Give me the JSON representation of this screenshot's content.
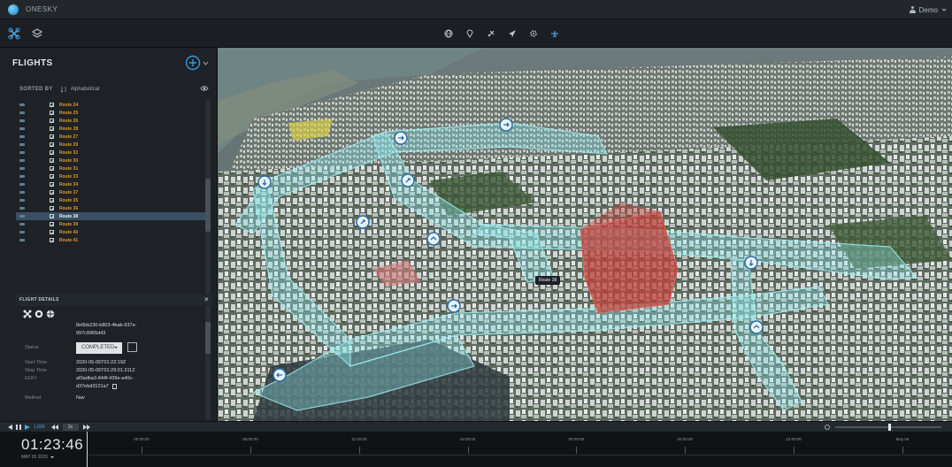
{
  "app": {
    "name": "ONESKY",
    "user": "Demo"
  },
  "colors": {
    "accent": "#1d8fe0",
    "route_label": "#e4962e",
    "corridor": "#7fe3ea",
    "zone": "#c2423c"
  },
  "toolbar": {
    "left_icons": [
      "drone-icon",
      "layers-icon"
    ],
    "center_icons": [
      "globe-icon",
      "pin-icon",
      "aircraft-icon",
      "send-icon",
      "settings-icon",
      "plane-icon"
    ]
  },
  "flights": {
    "title": "FLIGHTS",
    "sort_label": "SORTED BY",
    "sort_value": "Alphabetical",
    "routes": [
      {
        "name": "Route 24"
      },
      {
        "name": "Route 25"
      },
      {
        "name": "Route 26"
      },
      {
        "name": "Route 28"
      },
      {
        "name": "Route 27"
      },
      {
        "name": "Route 29"
      },
      {
        "name": "Route 32"
      },
      {
        "name": "Route 30"
      },
      {
        "name": "Route 31"
      },
      {
        "name": "Route 33"
      },
      {
        "name": "Route 34"
      },
      {
        "name": "Route 37"
      },
      {
        "name": "Route 35"
      },
      {
        "name": "Route 36"
      },
      {
        "name": "Route 38",
        "selected": true
      },
      {
        "name": "Route 39"
      },
      {
        "name": "Route 40"
      },
      {
        "name": "Route 41"
      }
    ]
  },
  "flight_details": {
    "title": "FLIGHT DETAILS",
    "id_line1": "8e6bb230-b803-4bab-937e-",
    "id_line2": "997c9965d43",
    "status_label": "Status",
    "status_value": "COMPLETED",
    "start_label": "Start Time",
    "start_value": "2020-05-05T01:22:19Z",
    "stop_label": "Stop Time",
    "stop_value": "2020-05-05T01:29:01.311Z",
    "gufi_label": "GUFI",
    "gufi_line1": "af0adba3-844f-439e-a40c-",
    "gufi_line2": "d37ebd3121a7",
    "method_label": "Method",
    "method_value": "Nav"
  },
  "map": {
    "tooltip": "Route 38"
  },
  "playback": {
    "speed": "1.000",
    "step": "2x"
  },
  "timeline": {
    "clock": "01:23:46",
    "date": "MAY 05 2020",
    "ticks": [
      "00:00:00",
      "06:00:00",
      "12:00:00",
      "18:00:00",
      "00:00:00",
      "06:00:00",
      "12:00:00",
      "May 06"
    ]
  }
}
